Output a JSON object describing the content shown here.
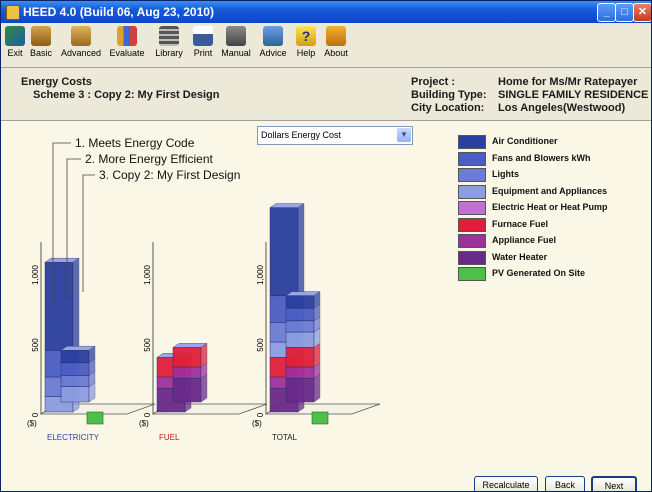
{
  "window": {
    "title": "HEED 4.0 (Build 06, Aug 23, 2010)"
  },
  "toolbar": {
    "items": [
      {
        "label": "Exit",
        "icon": "exit-icon"
      },
      {
        "label": "Basic",
        "icon": "chair-icon"
      },
      {
        "label": "Advanced",
        "icon": "chair-icon"
      },
      {
        "label": "Evaluate",
        "icon": "chart-icon"
      },
      {
        "label": "Library",
        "icon": "library-icon"
      },
      {
        "label": "Print",
        "icon": "printer-icon"
      },
      {
        "label": "Manual",
        "icon": "book-icon"
      },
      {
        "label": "Advice",
        "icon": "house-icon"
      },
      {
        "label": "Help",
        "icon": "question-icon"
      },
      {
        "label": "About",
        "icon": "about-icon"
      }
    ]
  },
  "header": {
    "section": "Energy Costs",
    "scheme": "Scheme 3 : Copy 2: My First Design",
    "project_label": "Project :",
    "project_value": "Home for Ms/Mr Ratepayer",
    "building_label": "Building Type:",
    "building_value": "SINGLE FAMILY RESIDENCE",
    "city_label": "City Location:",
    "city_value": "Los Angeles(Westwood)"
  },
  "dropdown": {
    "selected": "Dollars Energy Cost"
  },
  "chart_data": {
    "type": "bar",
    "stacking": "stacked, 3-D",
    "scheme_labels": [
      "1. Meets Energy Code",
      "2. More Energy Efficient",
      "3. Copy 2: My First Design"
    ],
    "panels": [
      "ELECTRICITY",
      "FUEL",
      "TOTAL"
    ],
    "y_ticks": [
      "0",
      "500",
      "1,000"
    ],
    "y_unit": "($)",
    "ylim": [
      0,
      1500
    ],
    "legend": [
      {
        "name": "Air Conditioner",
        "color": "#2a3f9e"
      },
      {
        "name": "Fans and Blowers kWh",
        "color": "#4a5ec4"
      },
      {
        "name": "Lights",
        "color": "#6a7cd4"
      },
      {
        "name": "Equipment and Appliances",
        "color": "#8b9ce0"
      },
      {
        "name": "Electric Heat or Heat Pump",
        "color": "#c070d0"
      },
      {
        "name": "Furnace Fuel",
        "color": "#e0203a"
      },
      {
        "name": "Appliance Fuel",
        "color": "#a0309a"
      },
      {
        "name": "Water Heater",
        "color": "#6a2a8a"
      },
      {
        "name": "PV Generated On Site",
        "color": "#4ec04a"
      }
    ],
    "series_values": {
      "ELECTRICITY": [
        {
          "scheme": "1. Meets Energy Code",
          "Air Conditioner": 630,
          "Fans and Blowers kWh": 190,
          "Lights": 140,
          "Equipment and Appliances": 110
        },
        {
          "scheme": "2. More Energy Efficient",
          "Air Conditioner": 90,
          "Fans and Blowers kWh": 90,
          "Lights": 80,
          "Equipment and Appliances": 110
        },
        {
          "scheme": "3. Copy 2: My First Design",
          "PV Generated On Site": 120
        }
      ],
      "FUEL": [
        {
          "scheme": "1. Meets Energy Code",
          "Furnace Fuel": 140,
          "Appliance Fuel": 80,
          "Water Heater": 170
        },
        {
          "scheme": "2. More Energy Efficient",
          "Furnace Fuel": 140,
          "Appliance Fuel": 80,
          "Water Heater": 170
        },
        {
          "scheme": "3. Copy 2: My First Design",
          "PV Generated On Site": 0
        }
      ],
      "TOTAL": [
        {
          "scheme": "1. Meets Energy Code",
          "Air Conditioner": 630,
          "Fans and Blowers kWh": 190,
          "Lights": 140,
          "Equipment and Appliances": 110,
          "Furnace Fuel": 140,
          "Appliance Fuel": 80,
          "Water Heater": 170
        },
        {
          "scheme": "2. More Energy Efficient",
          "Air Conditioner": 90,
          "Fans and Blowers kWh": 90,
          "Lights": 80,
          "Equipment and Appliances": 110,
          "Furnace Fuel": 140,
          "Appliance Fuel": 80,
          "Water Heater": 170
        },
        {
          "scheme": "3. Copy 2: My First Design",
          "PV Generated On Site": 120
        }
      ]
    }
  },
  "buttons": {
    "recalculate": "Recalculate",
    "back": "Back",
    "next": "Next"
  }
}
